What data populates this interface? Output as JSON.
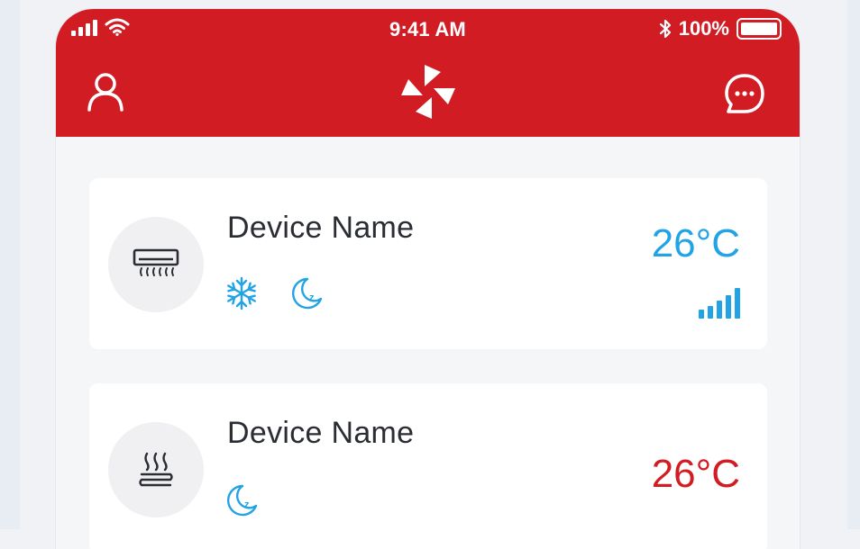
{
  "status_bar": {
    "time": "9:41 AM",
    "battery": "100%",
    "battery_level": 1.0
  },
  "header": {
    "icons": [
      "user-icon",
      "brand-logo-icon",
      "chat-icon"
    ]
  },
  "devices": [
    {
      "name": "Device Name",
      "temperature": "26°C",
      "type_icon": "air-conditioner-icon",
      "mode_icons": [
        "snowflake-icon",
        "sleep-moon-icon"
      ],
      "signal_bars": 5,
      "temperature_color": "#22a3e6"
    },
    {
      "name": "Device Name",
      "temperature": "26°C",
      "type_icon": "floor-heating-icon",
      "mode_icons": [
        "sleep-moon-icon"
      ],
      "temperature_color": "#d21c24"
    }
  ],
  "colors": {
    "brand_red": "#d21c24",
    "accent_blue": "#22a3e6",
    "card_bg": "#ffffff",
    "page_bg": "#f5f6f8"
  }
}
